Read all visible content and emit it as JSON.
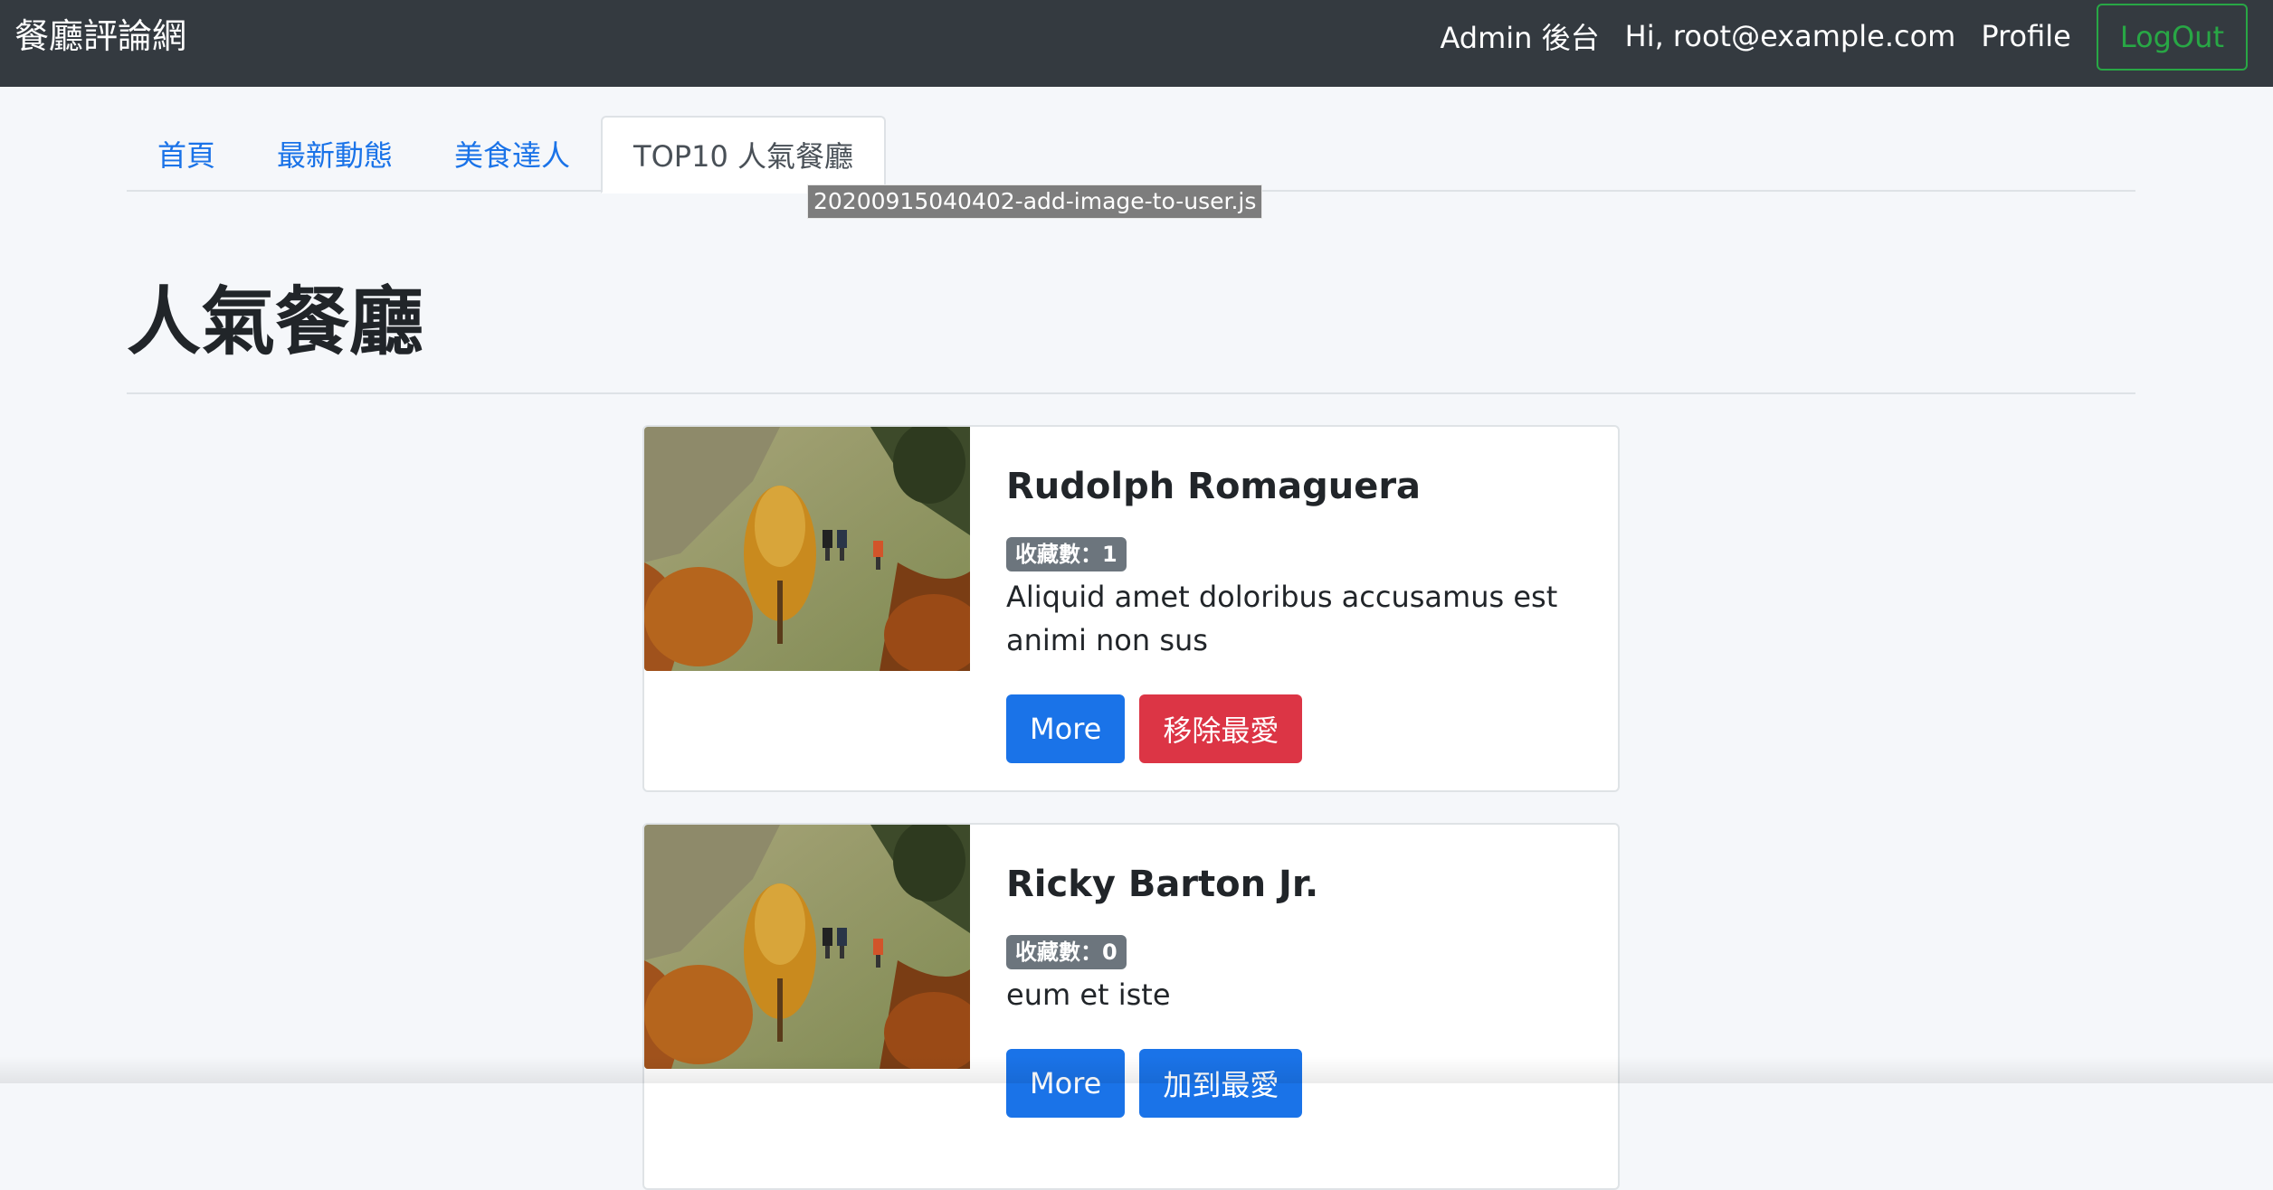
{
  "navbar": {
    "brand": "餐廳評論網",
    "admin_label": "Admin 後台",
    "greeting": "Hi, root@example.com",
    "profile_label": "Profile",
    "logout_label": "LogOut"
  },
  "tabs": [
    {
      "label": "首頁",
      "active": false
    },
    {
      "label": "最新動態",
      "active": false
    },
    {
      "label": "美食達人",
      "active": false
    },
    {
      "label": "TOP10 人氣餐廳",
      "active": true
    }
  ],
  "tooltip": "20200915040402-add-image-to-user.js",
  "page_title": "人氣餐廳",
  "restaurants": [
    {
      "name": "Rudolph Romaguera",
      "favorite_count": "收藏數：1",
      "description": "Aliquid amet doloribus accusamus est animi non sus",
      "more_label": "More",
      "favorite_action_label": "移除最愛",
      "favorited": true
    },
    {
      "name": "Ricky Barton Jr.",
      "favorite_count": "收藏數：0",
      "description": "eum et iste",
      "more_label": "More",
      "favorite_action_label": "加到最愛",
      "favorited": false
    }
  ],
  "colors": {
    "navbar_bg": "#343a40",
    "primary": "#1a73e8",
    "danger": "#dc3545",
    "success": "#28a745",
    "badge": "#6c757d"
  }
}
